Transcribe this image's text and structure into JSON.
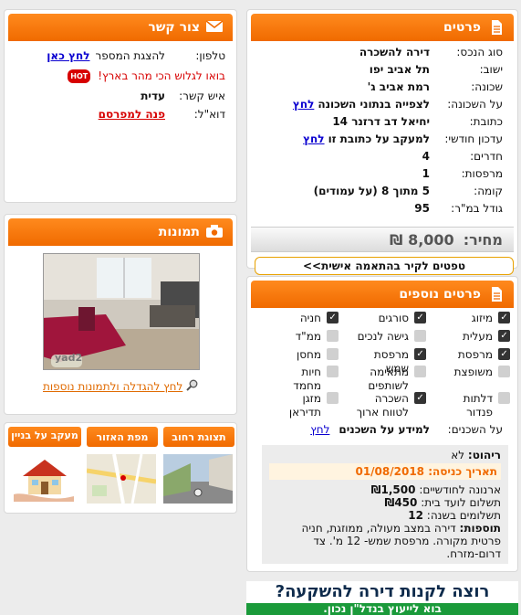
{
  "details": {
    "title": "פרטים",
    "rows": [
      {
        "label": "סוג הנכס:",
        "value": "דירה להשכרה"
      },
      {
        "label": "ישוב:",
        "value": "תל אביב יפו"
      },
      {
        "label": "שכונה:",
        "value": "רמת אביב ג'"
      },
      {
        "label": "על השכונה:",
        "value": "לצפייה בנתוני השכונה",
        "link": "לחץ"
      },
      {
        "label": "כתובת:",
        "value": "יחיאל דב דרזנר 14"
      },
      {
        "label": "עדכון חודשי:",
        "value": "למעקב על כתובת זו",
        "link": "לחץ"
      },
      {
        "label": "חדרים:",
        "value": "4"
      },
      {
        "label": "מרפסות:",
        "value": "1"
      },
      {
        "label": "קומה:",
        "value": "5 מתוך 8 (על עמודים)"
      },
      {
        "label": "גודל במ\"ר:",
        "value": "95"
      }
    ],
    "price_label": "מחיר:",
    "price": "8,000 ₪",
    "tips_button": "טפטים לקיר בהתאמה אישית>>"
  },
  "extra": {
    "title": "פרטים נוספים",
    "features": [
      {
        "label": "מיזוג",
        "checked": true
      },
      {
        "label": "סורגים",
        "checked": true
      },
      {
        "label": "חניה",
        "checked": true
      },
      {
        "label": "מעלית",
        "checked": true
      },
      {
        "label": "גישה לנכים",
        "checked": false
      },
      {
        "label": "ממ\"ד",
        "checked": false
      },
      {
        "label": "מרפסת",
        "checked": true
      },
      {
        "label": "מרפסת שמש",
        "checked": true
      },
      {
        "label": "מחסן",
        "checked": false
      },
      {
        "label": "משופצת",
        "checked": false
      },
      {
        "label": "מתאימה לשותפים",
        "checked": false
      },
      {
        "label": "חיות מחמד",
        "checked": false
      },
      {
        "label": "דלתות פנדור",
        "checked": false
      },
      {
        "label": "השכרה לטווח ארוך",
        "checked": true
      },
      {
        "label": "מזגן תדיראן",
        "checked": false
      }
    ],
    "neighbors_label": "על השכנים:",
    "neighbors_text": "למידע על השכנים",
    "neighbors_link": "לחץ",
    "furnished_label": "ריהוט:",
    "furnished_value": "לא",
    "entry_label": "תאריך כניסה:",
    "entry_value": "01/08/2018",
    "arnona_label": "ארנונה לחודשיים:",
    "arnona_value": "₪1,500",
    "vaad_label": "תשלום לועד בית:",
    "vaad_value": "₪450",
    "payments_label": "תשלומים בשנה:",
    "payments_value": "12",
    "additions_label": "תוספות:",
    "additions_value": "דירה במצב מעולה, ממוזגת, חניה פרטית מקורה. מרפסת שמש- 12 מ'. צד דרום-מזרח."
  },
  "contact": {
    "title": "צור קשר",
    "phone_label": "טלפון:",
    "phone_text": "להצגת המספר",
    "phone_link": "לחץ כאן",
    "promo_text": "בואו לגלוש הכי מהר בארץ!",
    "promo_badge": "HOT",
    "person_label": "איש קשר:",
    "person_value": "עדית",
    "email_label": "דוא\"ל:",
    "email_link": "פנה למפרסם"
  },
  "photos": {
    "title": "תמונות",
    "watermark": "yad2",
    "enlarge_link": "לחץ להגדלה ולתמונות נוספות"
  },
  "tabs": {
    "street": "תצוגת רחוב",
    "map": "מפת האזור",
    "track": "מעקב על בניין"
  },
  "banner": {
    "line1": "רוצה לקנות דירה להשקעה?",
    "line2": "בוא לייעוץ בנדל\"ן נכון."
  },
  "colors": {
    "accent": "#f06a00",
    "link": "#0a00d0",
    "alert": "#d70000"
  }
}
